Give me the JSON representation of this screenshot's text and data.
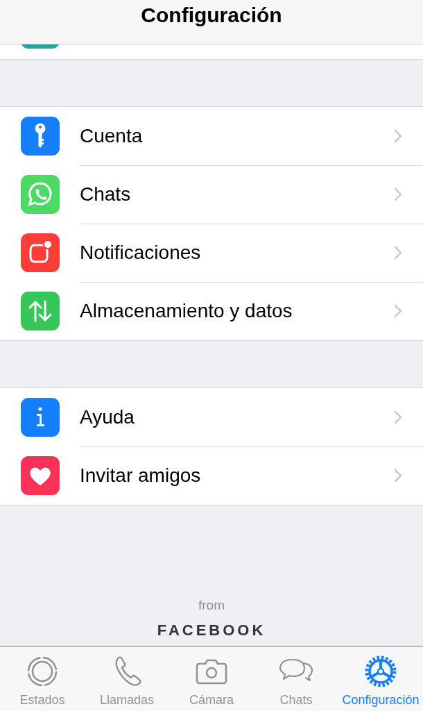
{
  "header": {
    "title": "Configuración"
  },
  "groups": [
    {
      "items": [
        {
          "label": "Cuenta",
          "kind": "key",
          "color": "#147efb"
        },
        {
          "label": "Chats",
          "kind": "whatsapp",
          "color": "#4cd964"
        },
        {
          "label": "Notificaciones",
          "kind": "notification",
          "color": "#fc3d39"
        },
        {
          "label": "Almacenamiento y datos",
          "kind": "arrows",
          "color": "#35c759"
        }
      ]
    },
    {
      "items": [
        {
          "label": "Ayuda",
          "kind": "info",
          "color": "#147efb"
        },
        {
          "label": "Invitar amigos",
          "kind": "heart",
          "color": "#fc3158"
        }
      ]
    }
  ],
  "footer": {
    "from": "from",
    "brand": "FACEBOOK"
  },
  "tab_bar": [
    {
      "label": "Estados",
      "kind": "status",
      "selected": false
    },
    {
      "label": "Llamadas",
      "kind": "phone",
      "selected": false
    },
    {
      "label": "Cámara",
      "kind": "camera",
      "selected": false
    },
    {
      "label": "Chats",
      "kind": "chats",
      "selected": false
    },
    {
      "label": "Configuración",
      "kind": "settings",
      "selected": true
    }
  ]
}
